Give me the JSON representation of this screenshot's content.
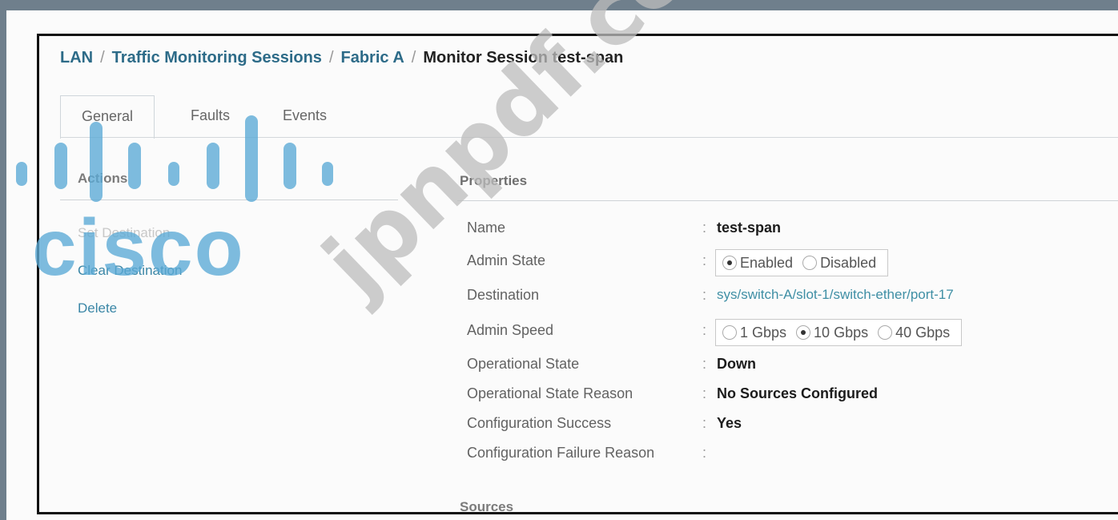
{
  "breadcrumb": {
    "items": [
      "LAN",
      "Traffic Monitoring Sessions",
      "Fabric A"
    ],
    "current": "Monitor Session test-span",
    "separator": "/"
  },
  "tabs": [
    {
      "label": "General",
      "active": true
    },
    {
      "label": "Faults",
      "active": false
    },
    {
      "label": "Events",
      "active": false
    }
  ],
  "actions": {
    "title": "Actions",
    "items": [
      "Set Destination",
      "Clear Destination",
      "Delete"
    ]
  },
  "properties": {
    "title": "Properties",
    "rows": {
      "name": {
        "label": "Name",
        "value": "test-span"
      },
      "admin_state": {
        "label": "Admin State",
        "options": [
          "Enabled",
          "Disabled"
        ],
        "selected": "Enabled"
      },
      "destination": {
        "label": "Destination",
        "value": "sys/switch-A/slot-1/switch-ether/port-17"
      },
      "admin_speed": {
        "label": "Admin Speed",
        "options": [
          "1 Gbps",
          "10 Gbps",
          "40 Gbps"
        ],
        "selected": "10 Gbps"
      },
      "operational_state": {
        "label": "Operational State",
        "value": "Down"
      },
      "operational_state_reason": {
        "label": "Operational State Reason",
        "value": "No Sources Configured"
      },
      "configuration_success": {
        "label": "Configuration Success",
        "value": "Yes"
      },
      "configuration_failure_reason": {
        "label": "Configuration Failure Reason",
        "value": ""
      }
    },
    "colon": ":"
  },
  "sources": {
    "title": "Sources"
  },
  "watermark": {
    "logo": "cisco",
    "text": "jpnpdf.com"
  },
  "colors": {
    "link": "#2d6b88",
    "value_link": "#3f8fa5",
    "logo": "#5aaad6",
    "watermark": "#bdbdbd"
  }
}
